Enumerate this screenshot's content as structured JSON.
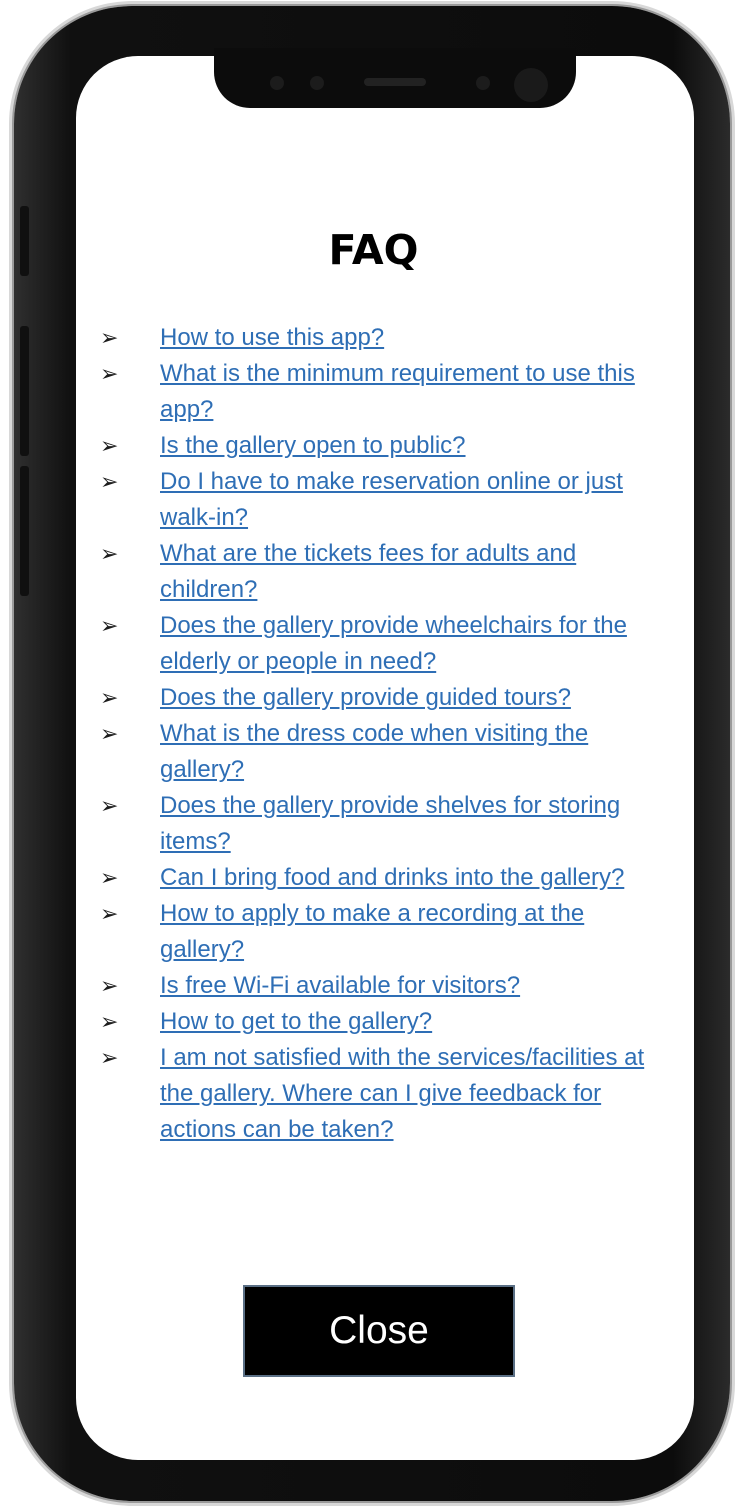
{
  "faq": {
    "title": "FAQ",
    "items": [
      {
        "label": "How to use this app?"
      },
      {
        "label": "What is the minimum requirement to use this app?"
      },
      {
        "label": "Is the gallery open to public?"
      },
      {
        "label": "Do I have to make reservation online or just walk-in?"
      },
      {
        "label": "What are the tickets fees for adults and children?"
      },
      {
        "label": "Does the gallery provide wheelchairs for the elderly or people in need?"
      },
      {
        "label": "Does the gallery provide guided tours?"
      },
      {
        "label": "What is the dress code when visiting the gallery?"
      },
      {
        "label": "Does the gallery provide shelves for storing items?"
      },
      {
        "label": "Can I bring food and drinks into the gallery?"
      },
      {
        "label": "How to apply to make a recording at the gallery?"
      },
      {
        "label": "Is free Wi-Fi available for visitors?"
      },
      {
        "label": "How to get to the gallery?"
      },
      {
        "label": "I am not satisfied with the services/facilities at the gallery. Where can I give feedback for actions can be taken?"
      }
    ],
    "bullet_icon": "arrow-right-icon",
    "link_color": "#2e6eb5"
  },
  "close_button": {
    "label": "Close"
  }
}
